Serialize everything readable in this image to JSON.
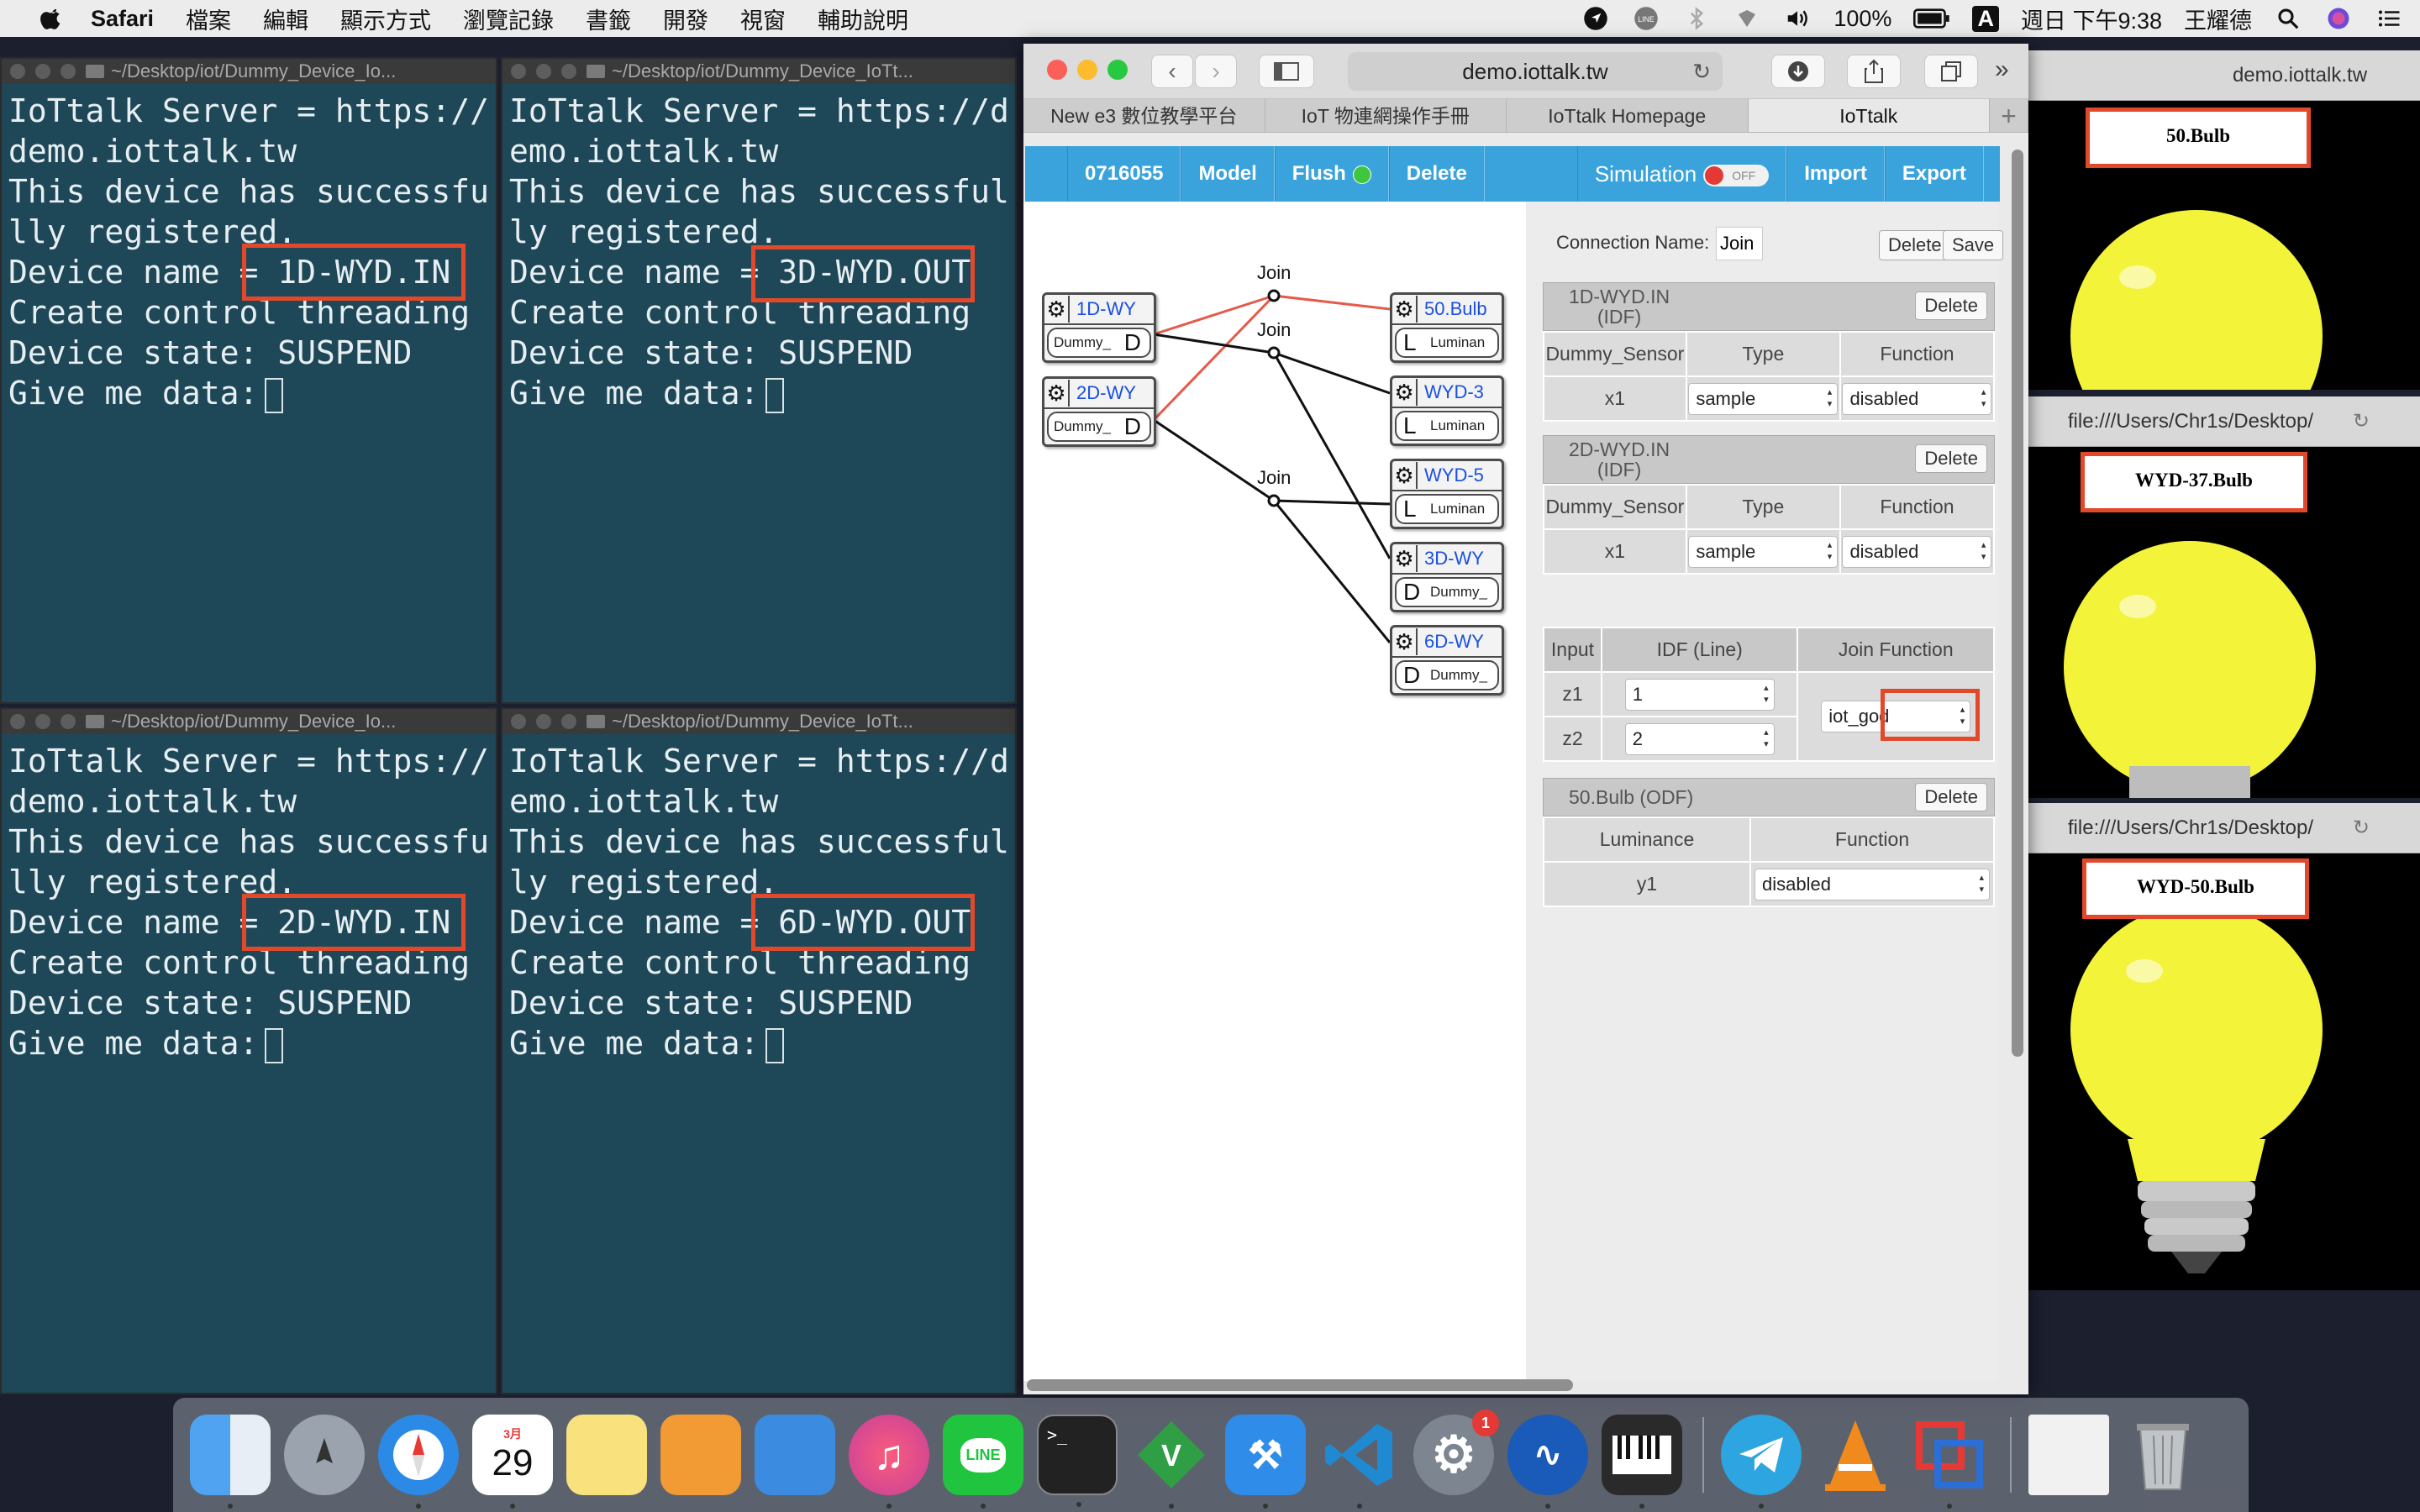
{
  "menubar": {
    "app": "Safari",
    "items": [
      "檔案",
      "編輯",
      "顯示方式",
      "瀏覽記錄",
      "書籤",
      "開發",
      "視窗",
      "輔助說明"
    ],
    "battery": "100%",
    "input": "A",
    "clock": "週日 下午9:38",
    "user": "王耀德"
  },
  "terminals": [
    {
      "title": "~/Desktop/iot/Dummy_Device_Io...",
      "server": "IoTtalk Server = https://demo.iottalk.tw",
      "registered": "This device has successfully registered.",
      "device_label": "Device name = ",
      "device": "1D-WYD.IN",
      "thread": "Create control threading",
      "state": "Device state: SUSPEND",
      "prompt": "Give me data:"
    },
    {
      "title": "~/Desktop/iot/Dummy_Device_IoTt...",
      "server": "IoTtalk Server = https://demo.iottalk.tw",
      "registered": "This device has successfully registered.",
      "device_label": "Device name = ",
      "device": "3D-WYD.OUT",
      "thread": "Create control threading",
      "state": "Device state: SUSPEND",
      "prompt": "Give me data:"
    },
    {
      "title": "~/Desktop/iot/Dummy_Device_Io...",
      "server": "IoTtalk Server = https://demo.iottalk.tw",
      "registered": "This device has successfully registered.",
      "device_label": "Device name = ",
      "device": "2D-WYD.IN",
      "thread": "Create control threading",
      "state": "Device state: SUSPEND",
      "prompt": "Give me data:"
    },
    {
      "title": "~/Desktop/iot/Dummy_Device_IoTt...",
      "server": "IoTtalk Server = https://demo.iottalk.tw",
      "registered": "This device has successfully registered.",
      "device_label": "Device name = ",
      "device": "6D-WYD.OUT",
      "thread": "Create control threading",
      "state": "Device state: SUSPEND",
      "prompt": "Give me data:"
    }
  ],
  "safari": {
    "address": "demo.iottalk.tw",
    "tabs": [
      "New e3 數位教學平台",
      "IoT 物連網操作手冊",
      "IoTtalk Homepage",
      "IoTtalk"
    ],
    "active_tab": 3
  },
  "iottalk": {
    "toolbar": {
      "project": "0716055",
      "model": "Model",
      "flush": "Flush",
      "delete": "Delete",
      "simulation": "Simulation",
      "sim_state": "OFF",
      "import": "Import",
      "export": "Export"
    },
    "input_devices": [
      {
        "name": "1D-WY",
        "feature": "Dummy_",
        "letter": "D"
      },
      {
        "name": "2D-WY",
        "feature": "Dummy_",
        "letter": "D"
      }
    ],
    "output_devices": [
      {
        "name": "50.Bulb",
        "feature": "Luminan",
        "letter": "L"
      },
      {
        "name": "WYD-3",
        "feature": "Luminan",
        "letter": "L"
      },
      {
        "name": "WYD-5",
        "feature": "Luminan",
        "letter": "L"
      },
      {
        "name": "3D-WY",
        "feature": "Dummy_",
        "letter": "D"
      },
      {
        "name": "6D-WY",
        "feature": "Dummy_",
        "letter": "D"
      }
    ],
    "joins": [
      "Join",
      "Join",
      "Join"
    ],
    "panel": {
      "conn_label": "Connection Name:",
      "conn_value": "Join",
      "delete": "Delete",
      "save": "Save",
      "idf1": {
        "title": "1D-WYD.IN",
        "sub": "(IDF)",
        "cols": [
          "Dummy_Sensor",
          "Type",
          "Function"
        ],
        "row": "x1",
        "type": "sample",
        "func": "disabled"
      },
      "idf2": {
        "title": "2D-WYD.IN",
        "sub": "(IDF)",
        "cols": [
          "Dummy_Sensor",
          "Type",
          "Function"
        ],
        "row": "x1",
        "type": "sample",
        "func": "disabled"
      },
      "join": {
        "cols": [
          "Input",
          "IDF (Line)",
          "Join Function"
        ],
        "rows": [
          {
            "name": "z1",
            "val": "1"
          },
          {
            "name": "z2",
            "val": "2"
          }
        ],
        "func": "iot_god"
      },
      "odf": {
        "title": "50.Bulb (ODF)",
        "cols": [
          "Luminance",
          "Function"
        ],
        "row": "y1",
        "func": "disabled"
      }
    }
  },
  "bulbs": [
    {
      "url": "demo.iottalk.tw",
      "label": "50.Bulb"
    },
    {
      "url": "file:///Users/Chr1s/Desktop/",
      "label": "WYD-37.Bulb"
    },
    {
      "url": "file:///Users/Chr1s/Desktop/",
      "label": "WYD-50.Bulb"
    }
  ],
  "dock": {
    "apps": [
      "Finder",
      "Launchpad",
      "Safari",
      "Calendar",
      "Notes",
      "Pages",
      "Keynote",
      "Music",
      "LINE",
      "Terminal",
      "Vim",
      "Xcode",
      "VS Code",
      "System Preferences",
      "Sound Control",
      "Piano",
      "Telegram",
      "VLC",
      "Parallels",
      "Documents",
      "Trash"
    ],
    "calendar_month": "3月",
    "calendar_day": "29",
    "badge": "1"
  },
  "colors": {
    "terminal_bg": "#1e4758",
    "highlight": "#e2492b",
    "iot_bar": "#3aa3dc",
    "bulb": "#f3f33a"
  }
}
